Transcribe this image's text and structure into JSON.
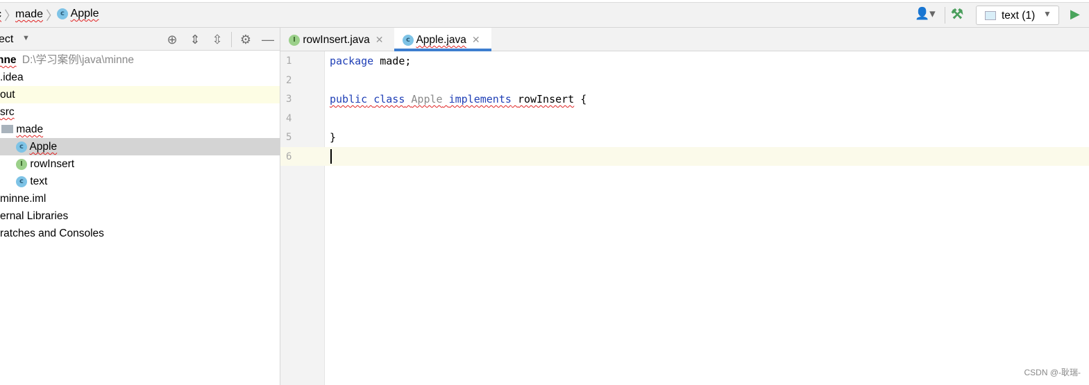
{
  "breadcrumb": {
    "items": [
      "c",
      "made",
      "Apple"
    ]
  },
  "toolbar": {
    "run_config": "text (1)"
  },
  "project_panel": {
    "title": "ect",
    "tree": [
      {
        "label": "nne",
        "path": "D:\\学习案例\\java\\minne"
      },
      {
        "label": ".idea"
      },
      {
        "label": "out"
      },
      {
        "label": "src"
      },
      {
        "label": "made"
      },
      {
        "label": "Apple"
      },
      {
        "label": "rowInsert"
      },
      {
        "label": "text"
      },
      {
        "label": "minne.iml"
      },
      {
        "label": "ernal Libraries"
      },
      {
        "label": "ratches and Consoles"
      }
    ]
  },
  "tabs": [
    {
      "label": "rowInsert.java",
      "icon": "interface-icon"
    },
    {
      "label": "Apple.java",
      "icon": "class-icon",
      "active": true
    }
  ],
  "editor": {
    "line_numbers": [
      "1",
      "2",
      "3",
      "4",
      "5",
      "6"
    ],
    "l1": {
      "kw": "package",
      "rest": " made;"
    },
    "l3": {
      "kw1": "public",
      "kw2": "class",
      "name": "Apple",
      "kw3": "implements",
      "iface": "rowInsert",
      "brace": " {"
    },
    "l5": "}"
  },
  "watermark": "CSDN @-耿瑞-",
  "colors": {
    "accent": "#3d7ecf",
    "keyword": "#1f3fb6",
    "class_icon": "#7ec3e6",
    "interface_icon": "#9bd08a"
  }
}
